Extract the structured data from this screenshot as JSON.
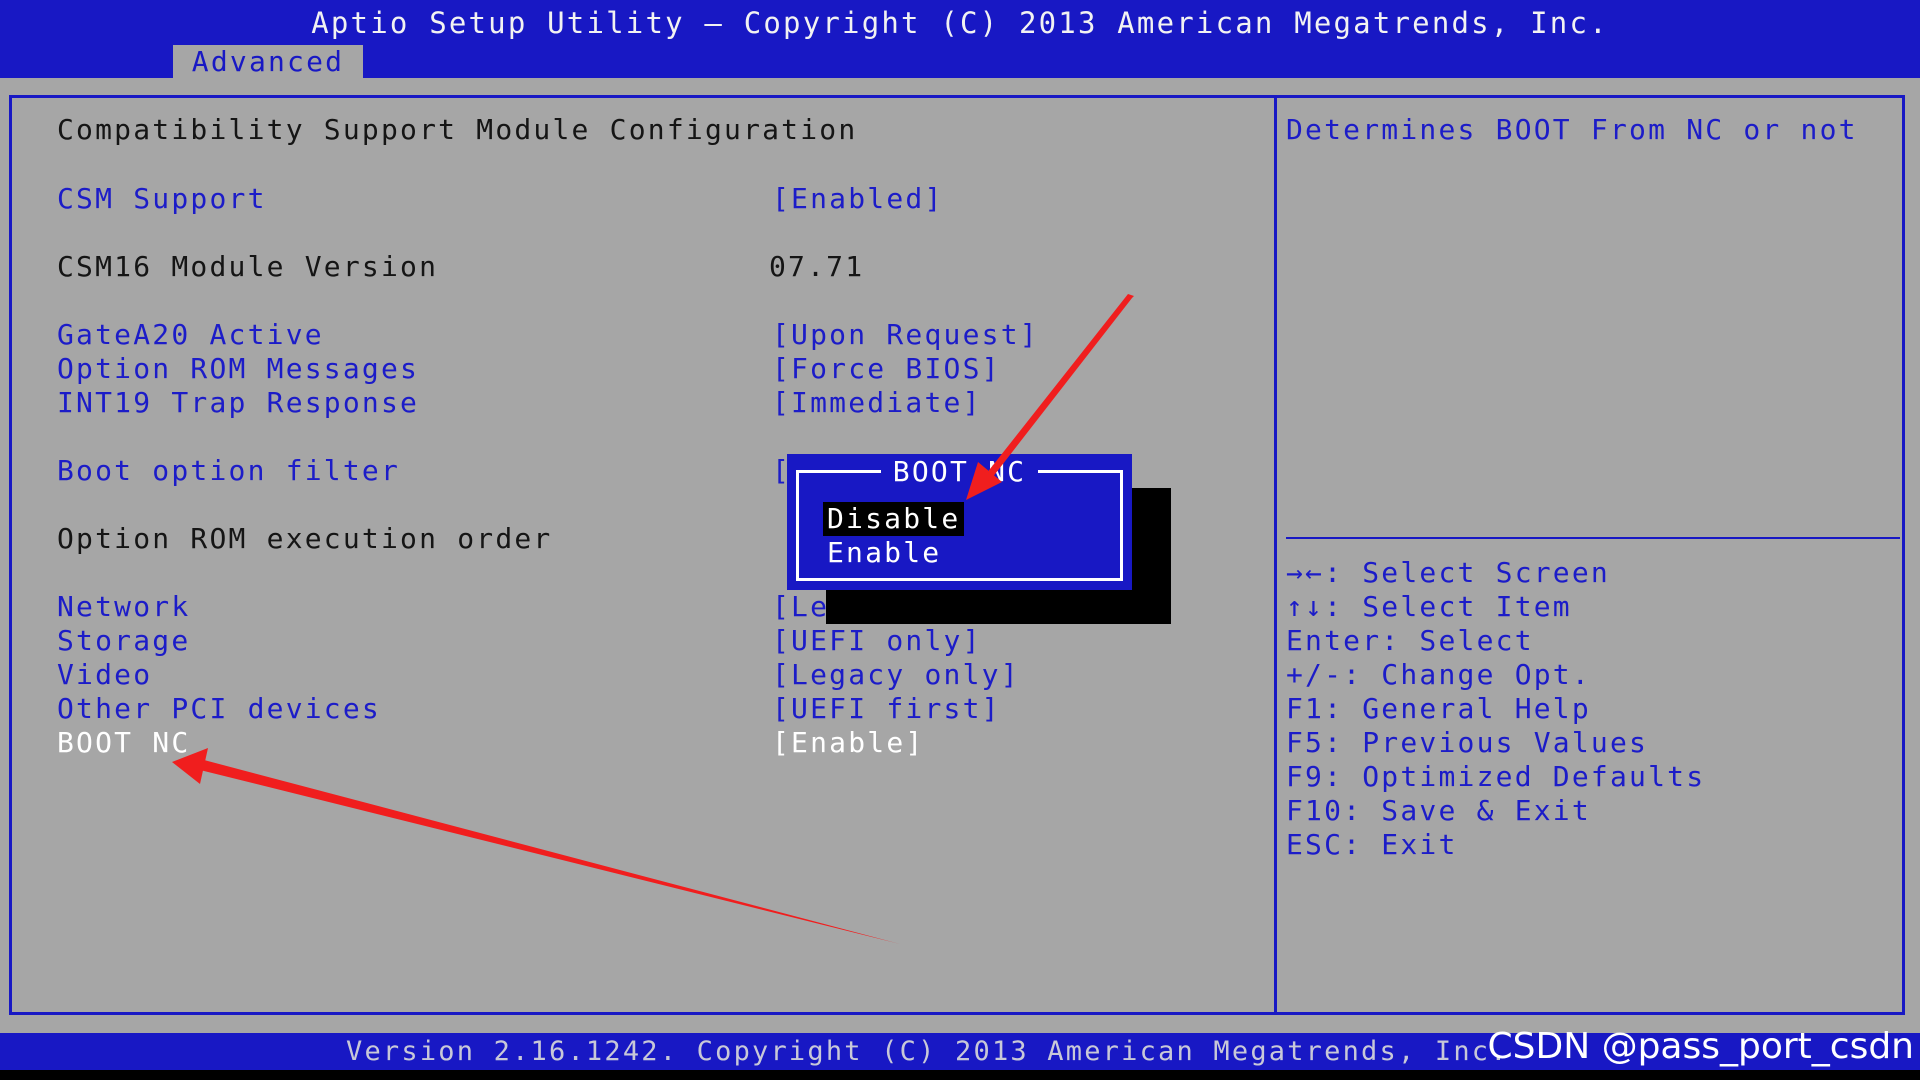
{
  "header": {
    "title": "Aptio Setup Utility – Copyright (C) 2013 American Megatrends, Inc.",
    "active_tab": "Advanced"
  },
  "page": {
    "heading": "Compatibility Support Module Configuration"
  },
  "settings": [
    {
      "label": "CSM Support",
      "value": "[Enabled]"
    },
    {
      "label": "CSM16 Module Version",
      "value": "07.71"
    },
    {
      "label": "GateA20 Active",
      "value": "[Upon Request]"
    },
    {
      "label": "Option ROM Messages",
      "value": "[Force BIOS]"
    },
    {
      "label": "INT19 Trap Response",
      "value": "[Immediate]"
    },
    {
      "label": "Boot option filter",
      "value": "["
    },
    {
      "label": "Option ROM execution order",
      "value": ""
    },
    {
      "label": "Network",
      "value": "[Le"
    },
    {
      "label": "Storage",
      "value": "[UEFI only]"
    },
    {
      "label": "Video",
      "value": "[Legacy only]"
    },
    {
      "label": "Other PCI devices",
      "value": "[UEFI first]"
    },
    {
      "label": "BOOT NC",
      "value": "[Enable]"
    }
  ],
  "help": {
    "description": "Determines BOOT From NC or not",
    "keys": [
      "→←: Select Screen",
      "↑↓: Select Item",
      "Enter: Select",
      "+/-: Change Opt.",
      "F1: General Help",
      "F5: Previous Values",
      "F9: Optimized Defaults",
      "F10: Save & Exit",
      "ESC: Exit"
    ]
  },
  "popup": {
    "title": "BOOT NC",
    "options": [
      "Disable",
      "Enable"
    ],
    "selected": "Disable"
  },
  "footer": {
    "version": "Version 2.16.1242. Copyright (C) 2013 American Megatrends, Inc."
  },
  "watermark": "CSDN @pass_port_csdn",
  "colors": {
    "bios_blue": "#1818c4",
    "bios_gray": "#a6a6a6",
    "annotation_red": "#f01e1e"
  }
}
